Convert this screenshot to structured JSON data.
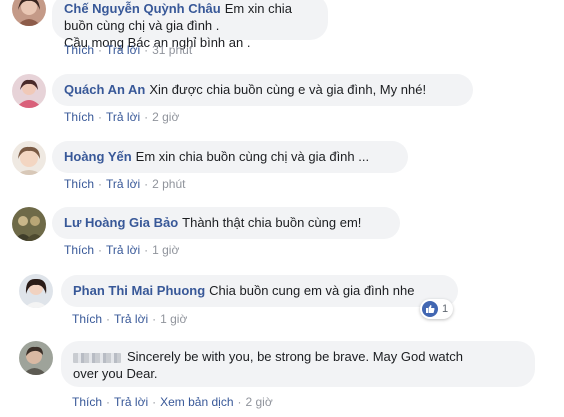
{
  "actions": {
    "like": "Thích",
    "reply": "Trả lời",
    "see_translation": "Xem bản dịch"
  },
  "comments": [
    {
      "name": "Chế Nguyễn Quỳnh Châu",
      "line1": "Em xin chia buồn cùng chị và gia đình .",
      "line2": "Cầu mong Bác an nghỉ bình an .",
      "time": "31 phút"
    },
    {
      "name": "Quách An An",
      "text": "Xin được chia buồn cùng e và gia đình, My nhé!",
      "time": "2 giờ"
    },
    {
      "name": "Hoàng Yến",
      "text": "Em xin chia buồn cùng chị và gia đình ...",
      "time": "2 phút"
    },
    {
      "name": "Lư Hoàng Gia Bảo",
      "text": "Thành thật chia buồn cùng em!",
      "time": "1 giờ"
    },
    {
      "name": "Phan Thi Mai Phuong",
      "text": "Chia buồn cung em và gia đình nhe",
      "time": "1 giờ",
      "reactions": "1"
    },
    {
      "line1": "Sincerely be with you, be strong be brave. May God watch",
      "line2": "over you Dear.",
      "time": "2 giờ"
    }
  ],
  "colors": {
    "name": "#385898",
    "bubble": "#f2f3f5",
    "meta": "#90949c",
    "like_blue": "#4267b2"
  }
}
